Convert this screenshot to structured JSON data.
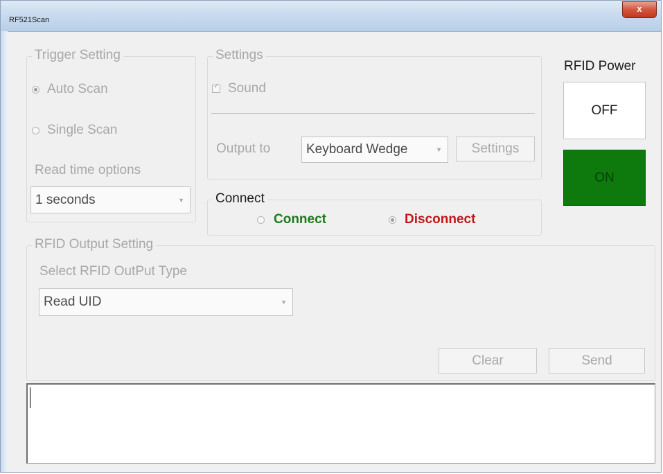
{
  "window": {
    "title": "RF521Scan",
    "close_label": "x"
  },
  "trigger": {
    "legend": "Trigger Setting",
    "auto_scan": "Auto Scan",
    "single_scan": "Single Scan",
    "selected": "Auto Scan",
    "read_time_label": "Read time options",
    "read_time_value": "1 seconds"
  },
  "settings": {
    "legend": "Settings",
    "sound_label": "Sound",
    "sound_checked": true,
    "output_to_label": "Output to",
    "output_value": "Keyboard Wedge",
    "settings_button": "Settings"
  },
  "connect": {
    "legend": "Connect",
    "connect_label": "Connect",
    "disconnect_label": "Disconnect",
    "selected": "Disconnect",
    "colors": {
      "connect": "#1e7a1e",
      "disconnect": "#c01818"
    }
  },
  "power": {
    "label": "RFID Power",
    "off_label": "OFF",
    "on_label": "ON",
    "colors": {
      "on": "#0e7a0e"
    }
  },
  "rfid_output": {
    "legend": "RFID Output Setting",
    "select_label": "Select RFID OutPut Type",
    "type_value": "Read UID",
    "clear_button": "Clear",
    "send_button": "Send"
  },
  "log": {
    "text": ""
  }
}
